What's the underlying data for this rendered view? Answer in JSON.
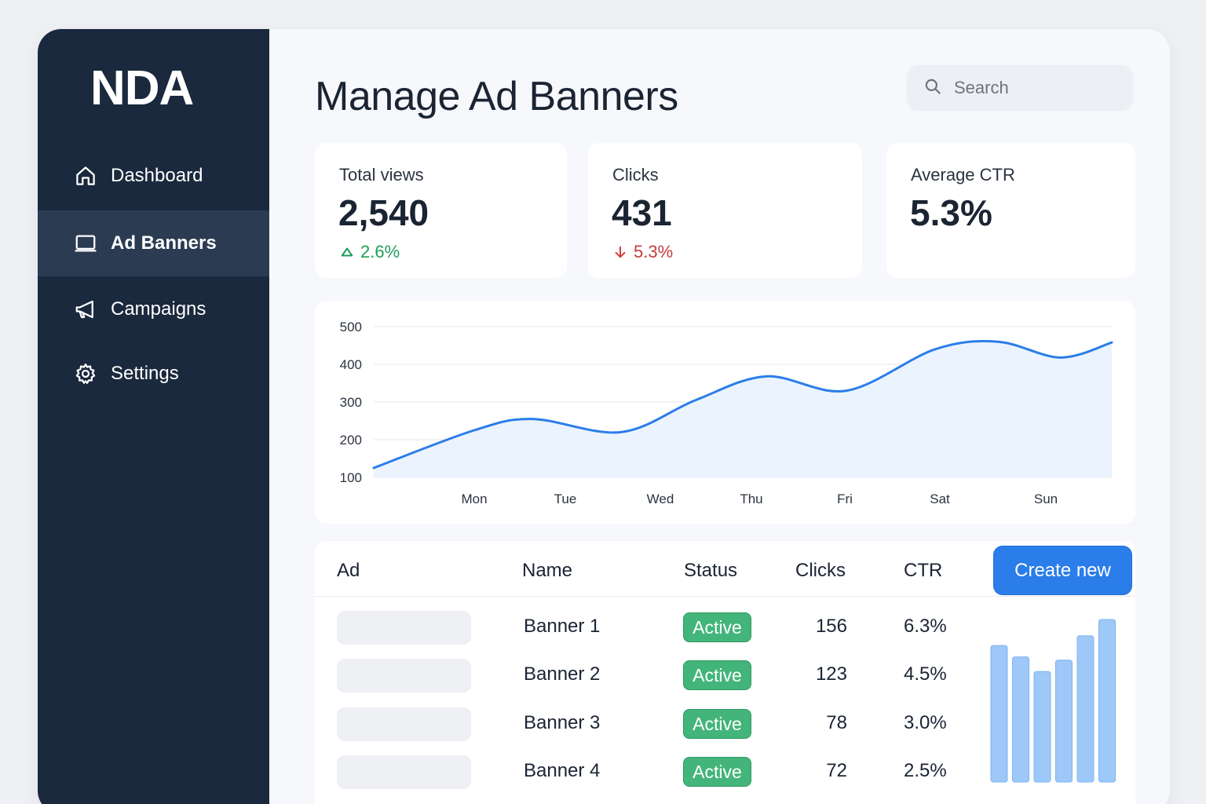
{
  "app": {
    "logo": "NDA"
  },
  "sidebar": {
    "items": [
      {
        "label": "Dashboard",
        "icon": "home-icon",
        "active": false
      },
      {
        "label": "Ad Banners",
        "icon": "monitor-icon",
        "active": true
      },
      {
        "label": "Campaigns",
        "icon": "megaphone-icon",
        "active": false
      },
      {
        "label": "Settings",
        "icon": "gear-icon",
        "active": false
      }
    ]
  },
  "header": {
    "title": "Manage Ad Banners",
    "search_placeholder": "Search"
  },
  "stats": [
    {
      "label": "Total views",
      "value": "2,540",
      "delta": "2.6%",
      "trend": "up"
    },
    {
      "label": "Clicks",
      "value": "431",
      "delta": "5.3%",
      "trend": "down"
    },
    {
      "label": "Average CTR",
      "value": "5.3%",
      "delta": "",
      "trend": "none"
    }
  ],
  "chart_data": {
    "type": "area",
    "categories": [
      "Mon",
      "Tue",
      "Wed",
      "Thu",
      "Fri",
      "Sat",
      "Sun"
    ],
    "y_ticks": [
      100,
      200,
      300,
      400,
      500
    ],
    "ylim": [
      100,
      500
    ],
    "points": [
      {
        "x": "Sat (start)",
        "y": 125
      },
      {
        "x": "Mon",
        "y": 225
      },
      {
        "x": "Mon-Tue",
        "y": 255
      },
      {
        "x": "Tue-Wed",
        "y": 220
      },
      {
        "x": "Wed-Thu",
        "y": 305
      },
      {
        "x": "Thu",
        "y": 368
      },
      {
        "x": "Fri",
        "y": 330
      },
      {
        "x": "Sat",
        "y": 440
      },
      {
        "x": "Sat-Sun",
        "y": 460
      },
      {
        "x": "Sun",
        "y": 418
      },
      {
        "x": "end",
        "y": 458
      }
    ],
    "values": [
      125,
      225,
      255,
      220,
      305,
      368,
      330,
      440,
      460,
      418,
      458
    ],
    "line_color": "#2b7de9",
    "fill_color": "#eaf3fe",
    "grid": true
  },
  "table": {
    "columns": [
      "Ad",
      "Name",
      "Status",
      "Clicks",
      "CTR"
    ],
    "create_label": "Create new",
    "rows": [
      {
        "name": "Banner 1",
        "status": "Active",
        "clicks": "156",
        "ctr": "6.3%"
      },
      {
        "name": "Banner 2",
        "status": "Active",
        "clicks": "123",
        "ctr": "4.5%"
      },
      {
        "name": "Banner 3",
        "status": "Active",
        "clicks": "78",
        "ctr": "3.0%"
      },
      {
        "name": "Banner 4",
        "status": "Active",
        "clicks": "72",
        "ctr": "2.5%"
      }
    ],
    "mini_bars": {
      "values": [
        0.84,
        0.77,
        0.68,
        0.75,
        0.9,
        1.0
      ],
      "color": "#9ec8f7"
    }
  }
}
